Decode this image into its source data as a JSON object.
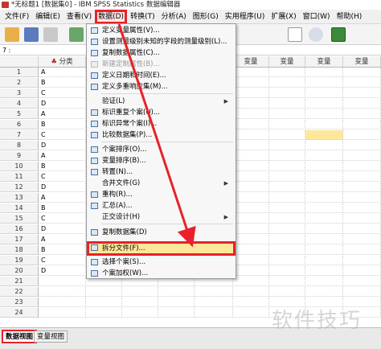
{
  "window": {
    "title": "*无标题1 [数据集0] - IBM SPSS Statistics 数据编辑器"
  },
  "menubar": {
    "items": [
      "文件(F)",
      "编辑(E)",
      "查看(V)",
      "数据(D)",
      "转换(T)",
      "分析(A)",
      "图形(G)",
      "实用程序(U)",
      "扩展(X)",
      "窗口(W)",
      "帮助(H)"
    ]
  },
  "cell_ref": "7 :",
  "grid": {
    "columns": [
      "分类",
      "变量",
      "变量",
      "变量",
      "变量",
      "变量",
      "变量",
      "变量",
      "变量"
    ],
    "rows": [
      {
        "n": "1",
        "v": "A"
      },
      {
        "n": "2",
        "v": "B"
      },
      {
        "n": "3",
        "v": "C"
      },
      {
        "n": "4",
        "v": "D"
      },
      {
        "n": "5",
        "v": "A"
      },
      {
        "n": "6",
        "v": "B"
      },
      {
        "n": "7",
        "v": "C"
      },
      {
        "n": "8",
        "v": "D"
      },
      {
        "n": "9",
        "v": "A"
      },
      {
        "n": "10",
        "v": "B"
      },
      {
        "n": "11",
        "v": "C"
      },
      {
        "n": "12",
        "v": "D"
      },
      {
        "n": "13",
        "v": "A"
      },
      {
        "n": "14",
        "v": "B"
      },
      {
        "n": "15",
        "v": "C"
      },
      {
        "n": "16",
        "v": "D"
      },
      {
        "n": "17",
        "v": "A"
      },
      {
        "n": "18",
        "v": "B"
      },
      {
        "n": "19",
        "v": "C"
      },
      {
        "n": "20",
        "v": "D"
      },
      {
        "n": "21",
        "v": ""
      },
      {
        "n": "22",
        "v": ""
      },
      {
        "n": "23",
        "v": ""
      },
      {
        "n": "24",
        "v": ""
      }
    ]
  },
  "data_menu": {
    "items": [
      {
        "label": "定义变量属性(V)...",
        "icon": "variable-properties-icon"
      },
      {
        "label": "设置测量级别未知的字段的测量级别(L)...",
        "icon": "measure-level-icon"
      },
      {
        "label": "复制数据属性(C)...",
        "icon": "copy-properties-icon"
      },
      {
        "label": "新建定制属性(B)...",
        "icon": "custom-attribute-icon"
      },
      {
        "label": "定义日期和时间(E)...",
        "icon": "date-time-icon"
      },
      {
        "label": "定义多重响应集(M)...",
        "icon": "multiple-response-icon"
      },
      {
        "label": "验证(L)",
        "icon": ""
      },
      {
        "label": "标识重复个案(U)...",
        "icon": "duplicate-cases-icon"
      },
      {
        "label": "标识异常个案(I)...",
        "icon": "unusual-cases-icon"
      },
      {
        "label": "比较数据集(P)...",
        "icon": "compare-datasets-icon"
      },
      {
        "label": "个案排序(O)...",
        "icon": "sort-cases-icon"
      },
      {
        "label": "变量排序(B)...",
        "icon": "sort-variables-icon"
      },
      {
        "label": "转置(N)...",
        "icon": "transpose-icon"
      },
      {
        "label": "合并文件(G)",
        "icon": ""
      },
      {
        "label": "重构(R)...",
        "icon": "restructure-icon"
      },
      {
        "label": "汇总(A)...",
        "icon": "aggregate-icon"
      },
      {
        "label": "正交设计(H)",
        "icon": ""
      },
      {
        "label": "复制数据集(D)",
        "icon": "copy-dataset-icon"
      },
      {
        "label": "拆分文件(F)...",
        "icon": "split-file-icon"
      },
      {
        "label": "选择个案(S)...",
        "icon": "select-cases-icon"
      },
      {
        "label": "个案加权(W)...",
        "icon": "weight-cases-icon"
      }
    ]
  },
  "tabs": {
    "data_view": "数据视图",
    "variable_view": "变量视图"
  },
  "watermark": "软件技巧",
  "colors": {
    "highlight": "#e8212a",
    "selection": "#fde79a"
  }
}
